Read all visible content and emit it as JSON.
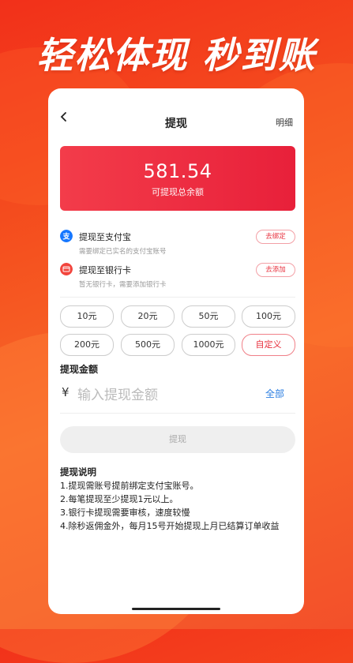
{
  "headline": "轻松体现 秒到账",
  "nav": {
    "title": "提现",
    "detail": "明细"
  },
  "balance": {
    "amount": "581.54",
    "label": "可提现总余额"
  },
  "methods": [
    {
      "name": "提现至支付宝",
      "sub": "需要绑定已实名的支付宝账号",
      "action": "去绑定",
      "icon": "alipay-icon",
      "color": "#1677ff"
    },
    {
      "name": "提现至银行卡",
      "sub": "暂无银行卡，需要添加银行卡",
      "action": "去添加",
      "icon": "bank-card-icon",
      "color": "#f2453d"
    }
  ],
  "chips": [
    "10元",
    "20元",
    "50元",
    "100元",
    "200元",
    "500元",
    "1000元",
    "自定义"
  ],
  "amount": {
    "label": "提现金额",
    "currency": "¥",
    "placeholder": "输入提现金额",
    "all": "全部"
  },
  "submit_label": "提现",
  "notes": {
    "title": "提现说明",
    "items": [
      "1.提现需账号提前绑定支付宝账号。",
      "2.每笔提现至少提现1元以上。",
      "3.银行卡提现需要审核，速度较慢",
      "4.除秒返佣金外，每月15号开始提现上月已结算订单收益"
    ]
  },
  "colors": {
    "accent": "#e8303d",
    "link": "#2a7de1"
  }
}
